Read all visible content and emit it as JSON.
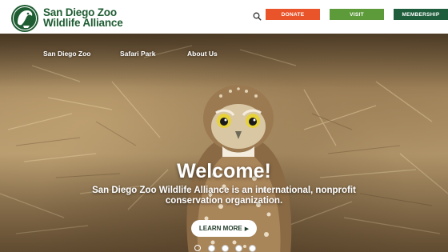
{
  "brand": {
    "line1": "San Diego Zoo",
    "line2": "Wildlife Alliance"
  },
  "header": {
    "donate_label": "DONATE",
    "visit_label": "VISIT",
    "membership_label": "MEMBERSHIP"
  },
  "nav": {
    "items": [
      {
        "label": "San Diego Zoo"
      },
      {
        "label": "Safari Park"
      },
      {
        "label": "About Us"
      }
    ]
  },
  "hero": {
    "heading": "Welcome!",
    "tagline": "San Diego Zoo Wildlife Alliance is an international, nonprofit conservation organization.",
    "cta_label": "LEARN MORE",
    "cta_arrow": "▶",
    "carousel": {
      "slides": 5,
      "active_index": 0
    }
  },
  "icons": {
    "logo": "owl-logo-icon",
    "search": "search-icon",
    "cta_arrow": "play-arrow-icon"
  },
  "colors": {
    "brand_green": "#1e5c32",
    "donate": "#e9542b",
    "visit": "#5c9a3a",
    "membership": "#1f5e3c"
  }
}
